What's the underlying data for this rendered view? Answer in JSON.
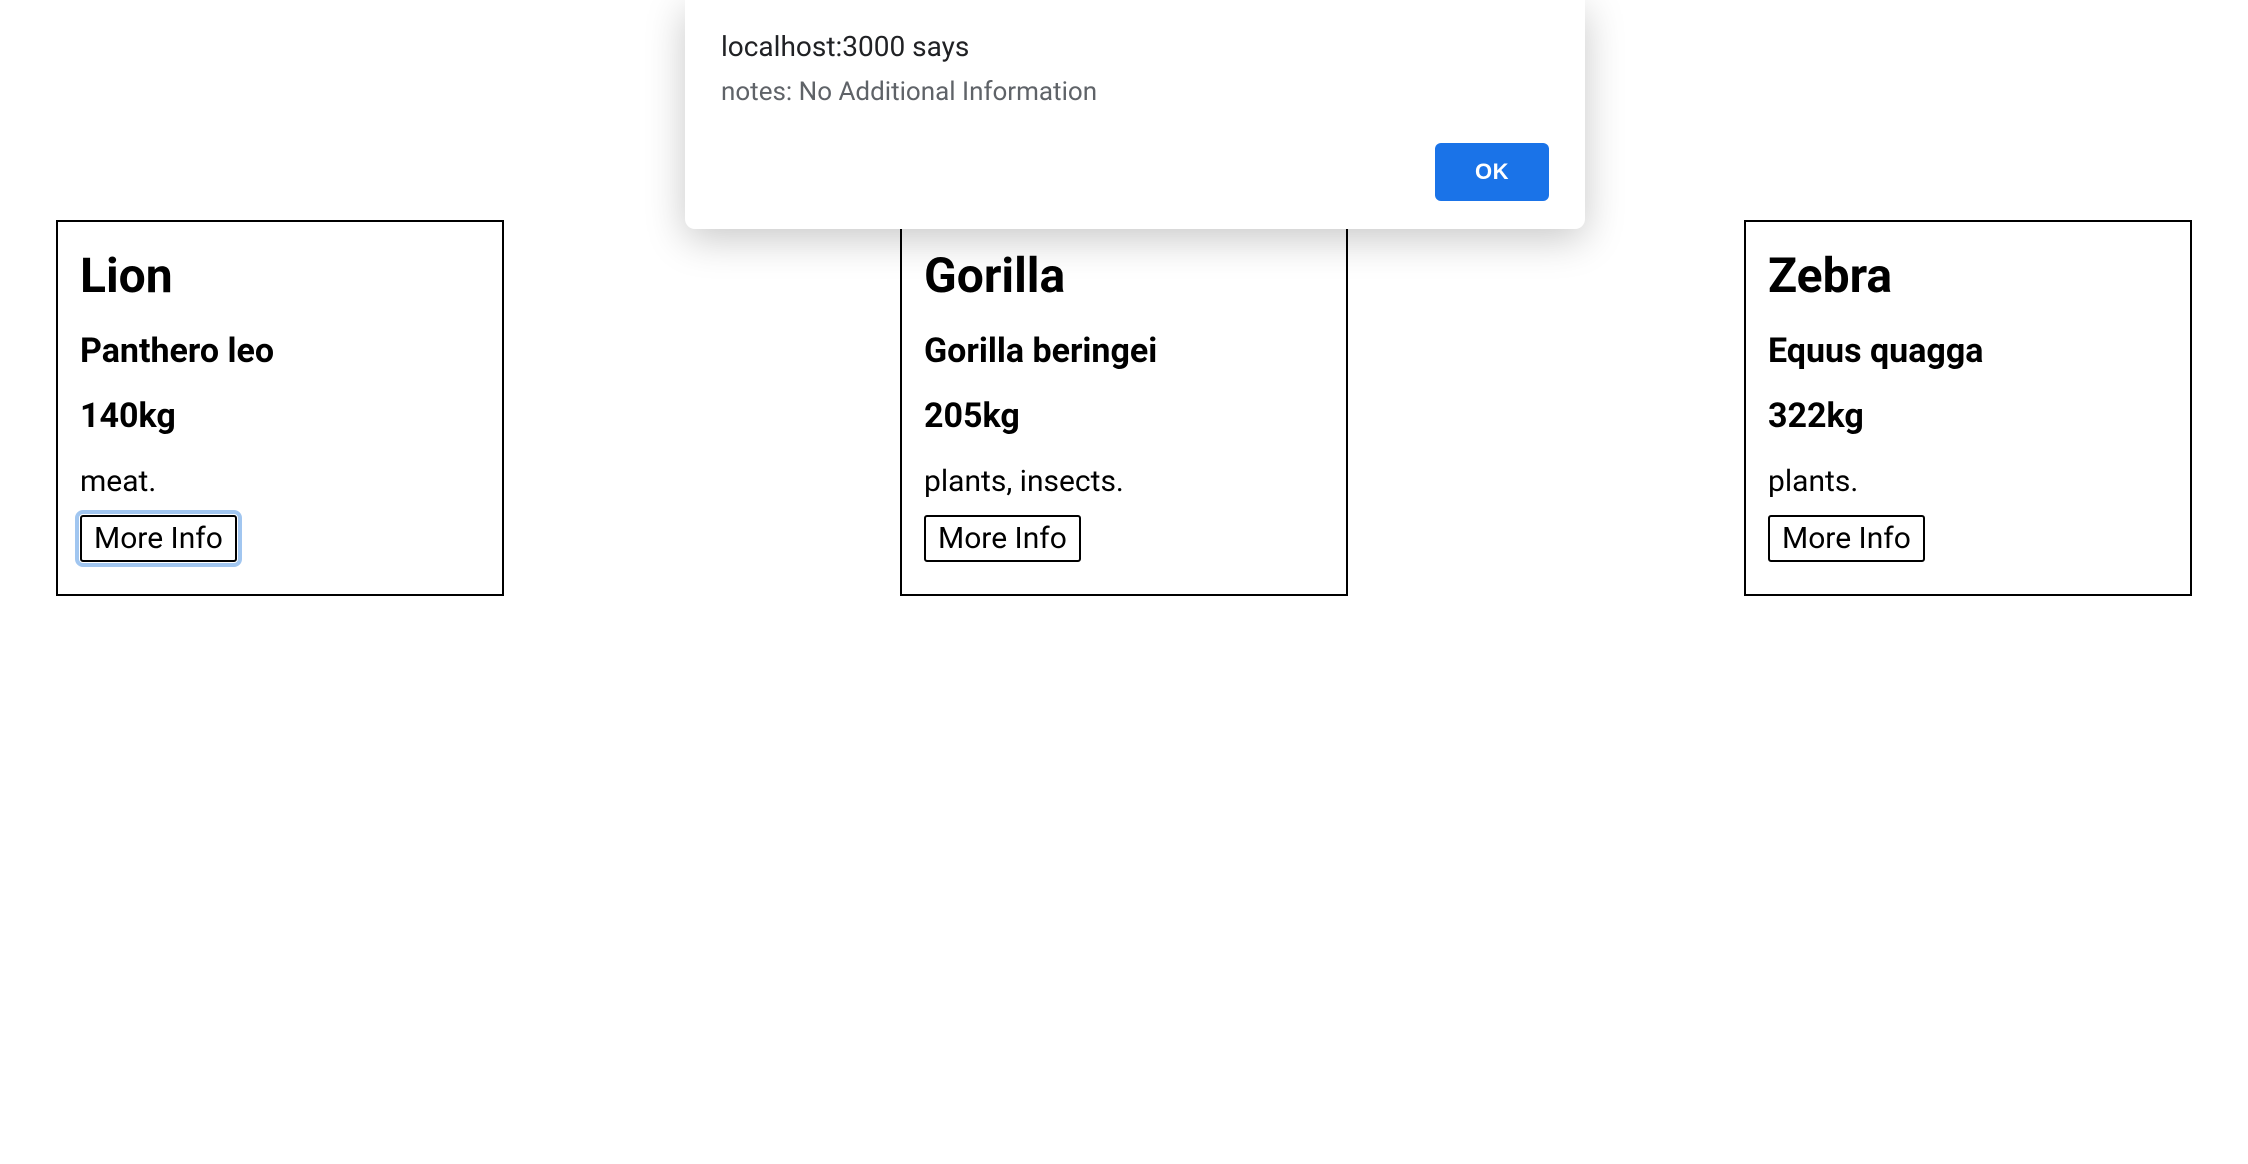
{
  "alert": {
    "title": "localhost:3000 says",
    "message": "notes: No Additional Information",
    "ok_label": "OK"
  },
  "cards": [
    {
      "name": "Lion",
      "scientific": "Panthero leo",
      "weight": "140kg",
      "diet": "meat.",
      "button_label": "More Info",
      "focused": true
    },
    {
      "name": "Gorilla",
      "scientific": "Gorilla beringei",
      "weight": "205kg",
      "diet": "plants, insects.",
      "button_label": "More Info",
      "focused": false
    },
    {
      "name": "Zebra",
      "scientific": "Equus quagga",
      "weight": "322kg",
      "diet": "plants.",
      "button_label": "More Info",
      "focused": false
    }
  ]
}
